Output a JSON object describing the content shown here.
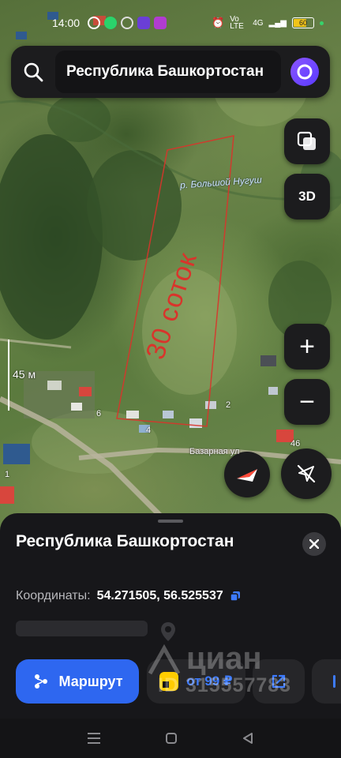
{
  "status_bar": {
    "time": "14:00",
    "network": "4G",
    "volte": "Vo LTE",
    "battery": "60"
  },
  "search": {
    "query": "Республика Башкортостан"
  },
  "map": {
    "buttons": {
      "three_d": "3D",
      "zoom_in": "+",
      "zoom_out": "−"
    },
    "scale": "45 м",
    "river": "р. Большой Нугуш",
    "street": "Базарная ул",
    "annotation": "30 соток",
    "house_numbers": [
      "6",
      "4",
      "2",
      "46",
      "1"
    ]
  },
  "place_card": {
    "title": "Республика Башкортостан",
    "coords_label": "Координаты:",
    "coords_value": "54.271505, 56.525537",
    "route_label": "Маршрут",
    "taxi_label": "от 99 ₽"
  },
  "watermark": {
    "brand": "циан",
    "id": "ID 315557783"
  },
  "colors": {
    "accent": "#2e67f0",
    "alice": "#7a4dff",
    "sheet_bg": "#17171a",
    "annotation": "#d9342b"
  }
}
